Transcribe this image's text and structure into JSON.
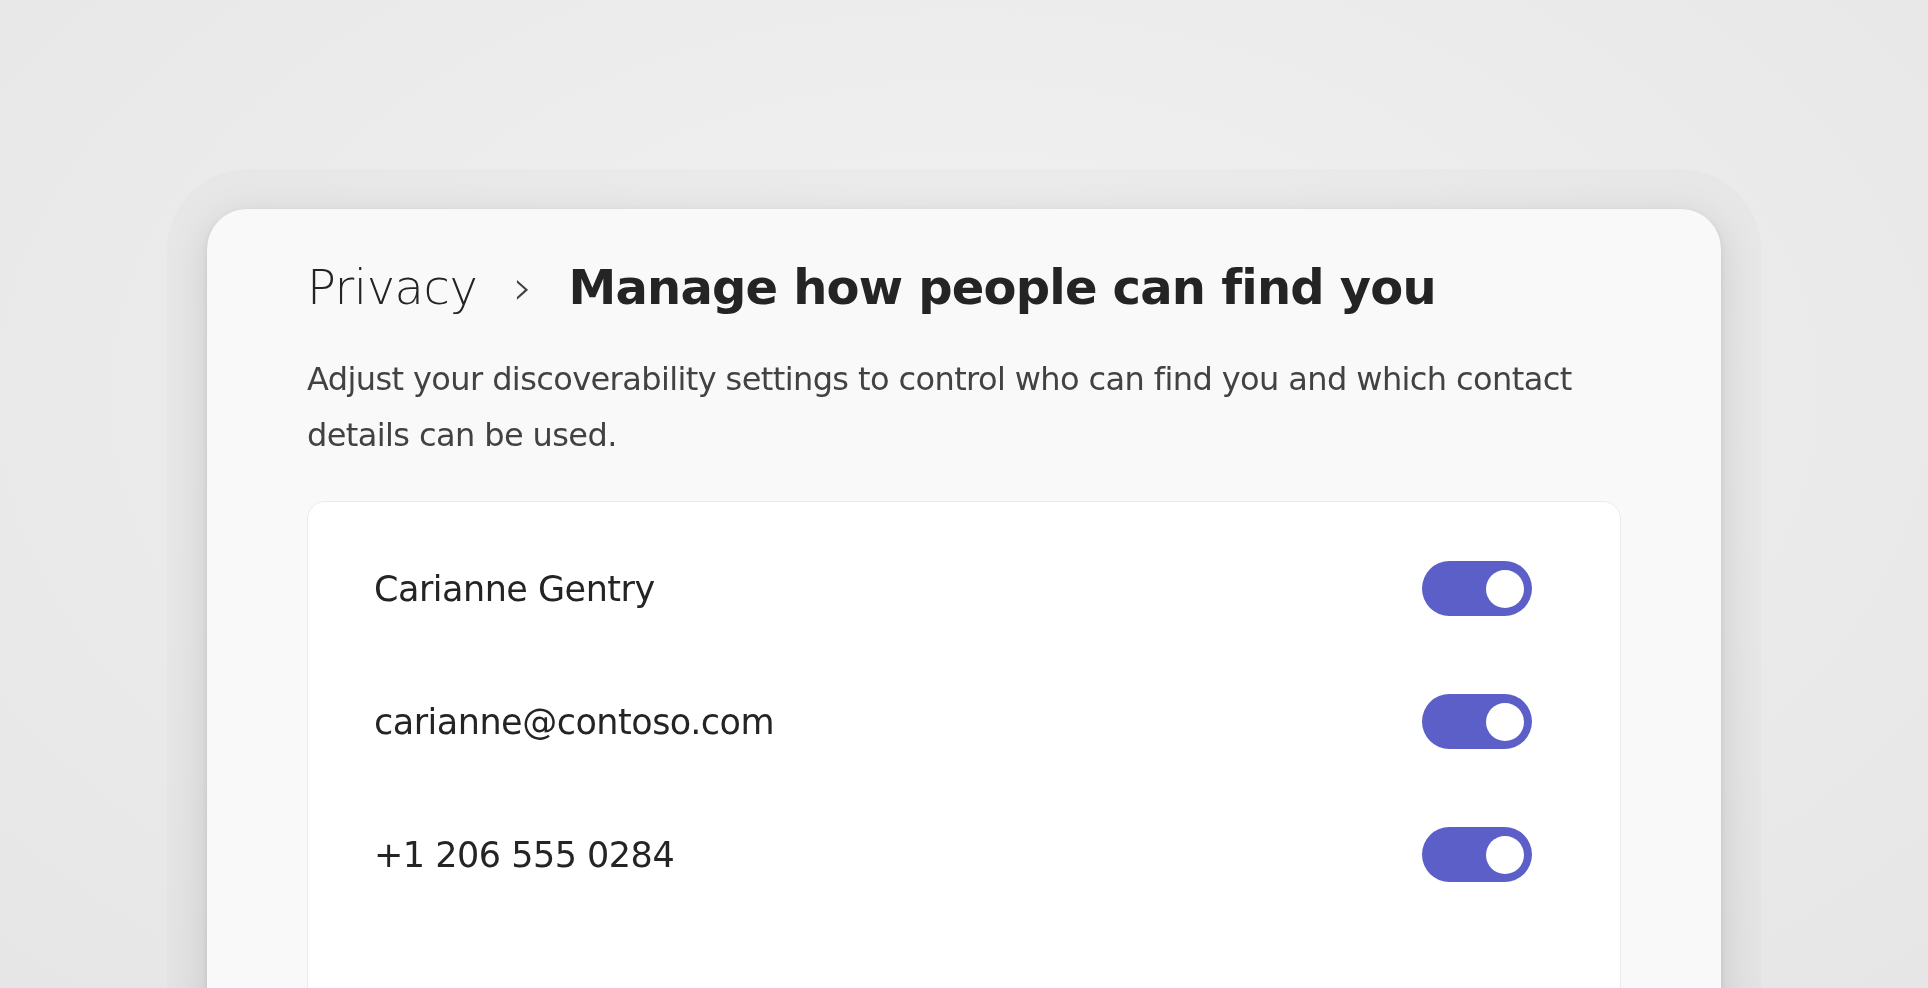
{
  "breadcrumb": {
    "parent": "Privacy",
    "separator": "›",
    "current": "Manage how people can find you"
  },
  "description": "Adjust your discoverability settings to control who can find you and which contact details can be used.",
  "settings": [
    {
      "label": "Carianne Gentry",
      "on": true
    },
    {
      "label": "carianne@contoso.com",
      "on": true
    },
    {
      "label": "+1 206 555 0284",
      "on": true
    }
  ]
}
